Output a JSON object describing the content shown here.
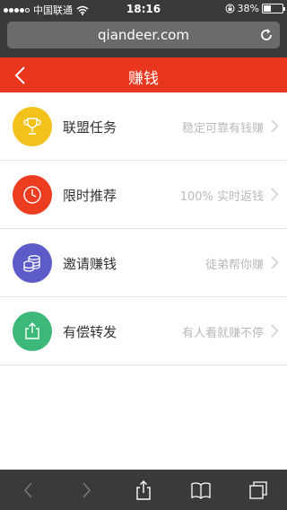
{
  "status_bar": {
    "carrier": "中国联通",
    "time": "18:16",
    "battery": "38%",
    "battery_level": 0.38
  },
  "browser": {
    "url": "qiandeer.com"
  },
  "header": {
    "title": "赚钱"
  },
  "items": [
    {
      "label": "联盟任务",
      "desc": "稳定可靠有钱赚",
      "icon": "trophy-icon",
      "color": "#f2c11b"
    },
    {
      "label": "限时推荐",
      "desc": "100% 实时返钱",
      "icon": "clock-icon",
      "color": "#ec3d20"
    },
    {
      "label": "邀请赚钱",
      "desc": "徒弟帮你赚",
      "icon": "coins-icon",
      "color": "#5d5bc8"
    },
    {
      "label": "有偿转发",
      "desc": "有人看就赚不停",
      "icon": "share-icon",
      "color": "#3cb878"
    }
  ],
  "colors": {
    "header": "#e8361f",
    "browser_chrome": "#3a3a3a"
  }
}
